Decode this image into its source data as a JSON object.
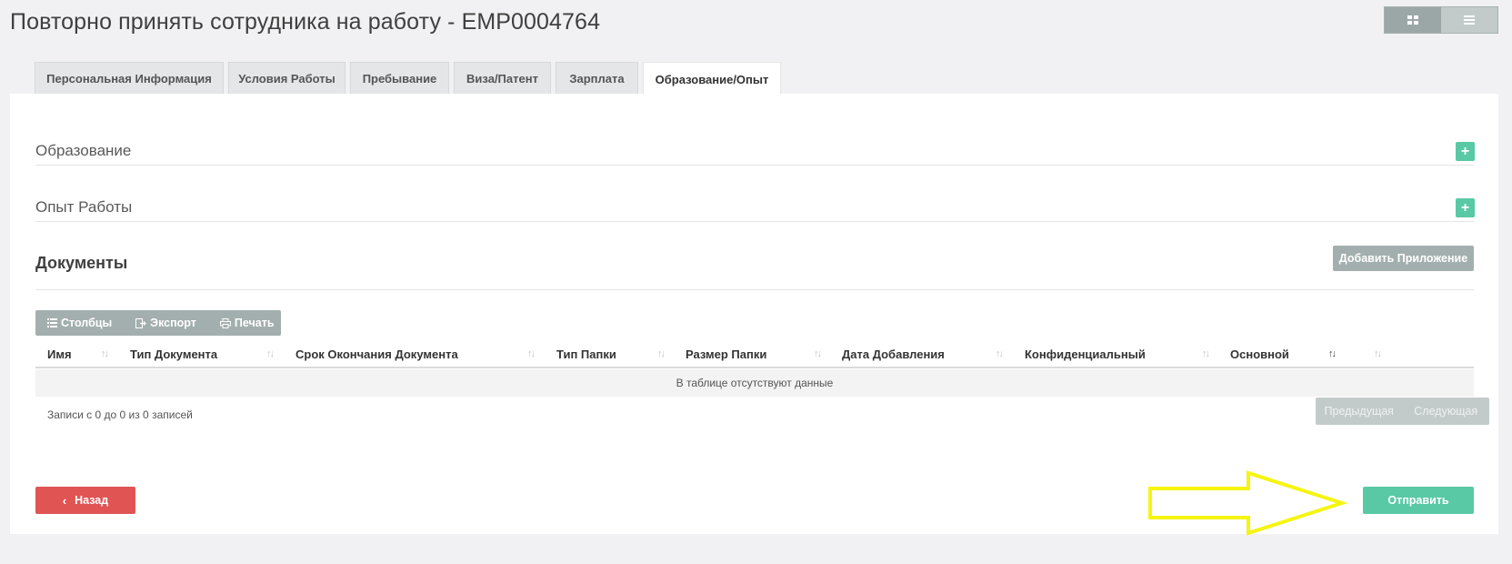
{
  "page": {
    "title": "Повторно принять сотрудника на работу - EMP0004764"
  },
  "view_toggle": {
    "grid_icon": "grid-icon",
    "list_icon": "list-icon"
  },
  "tabs": [
    {
      "label": "Персональная Информация",
      "active": false
    },
    {
      "label": "Условия Работы",
      "active": false
    },
    {
      "label": "Пребывание",
      "active": false
    },
    {
      "label": "Виза/Патент",
      "active": false
    },
    {
      "label": "Зарплата",
      "active": false
    },
    {
      "label": "Образование/Опыт",
      "active": true
    }
  ],
  "sections": {
    "education": {
      "title": "Образование",
      "add_label": "+"
    },
    "experience": {
      "title": "Опыт Работы",
      "add_label": "+"
    }
  },
  "documents": {
    "title": "Документы",
    "add_attachment_label": "Добавить Приложение",
    "toolbar": {
      "columns_label": "Столбцы",
      "export_label": "Экспорт",
      "print_label": "Печать"
    },
    "columns": [
      "Имя",
      "Тип Документа",
      "Срок Окончания Документа",
      "Тип Папки",
      "Размер Папки",
      "Дата Добавления",
      "Конфиденциальный",
      "Основной",
      ""
    ],
    "empty_message": "В таблице отсутствуют данные",
    "records_info": "Записи с 0 до 0 из 0 записей",
    "pagination": {
      "prev_label": "Предыдущая",
      "next_label": "Следующая"
    }
  },
  "actions": {
    "back_label": "Назад",
    "submit_label": "Отправить"
  },
  "colors": {
    "accent_green": "#59c9a5",
    "danger_red": "#e05554",
    "neutral_gray": "#a3afae",
    "annotation_yellow": "#f5f511"
  }
}
